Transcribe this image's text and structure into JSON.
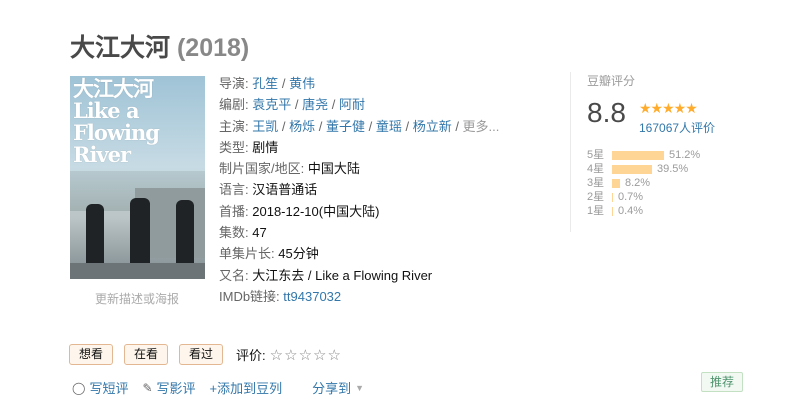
{
  "header": {
    "title": "大江大河",
    "year": "(2018)"
  },
  "poster": {
    "title_text": "大江大河\nLike a\nFlowing\nRiver",
    "update_link": "更新描述或海报"
  },
  "info": {
    "director": {
      "label": "导演:",
      "people": [
        "孔笙",
        "黄伟"
      ]
    },
    "writer": {
      "label": "编剧:",
      "people": [
        "袁克平",
        "唐尧",
        "阿耐"
      ]
    },
    "cast": {
      "label": "主演:",
      "people": [
        "王凯",
        "杨烁",
        "董子健",
        "童瑶",
        "杨立新"
      ],
      "more": "更多..."
    },
    "genre": {
      "label": "类型:",
      "value": "剧情"
    },
    "country": {
      "label": "制片国家/地区:",
      "value": "中国大陆"
    },
    "language": {
      "label": "语言:",
      "value": "汉语普通话"
    },
    "premiere": {
      "label": "首播:",
      "value": "2018-12-10(中国大陆)"
    },
    "episodes": {
      "label": "集数:",
      "value": "47"
    },
    "runtime": {
      "label": "单集片长:",
      "value": "45分钟"
    },
    "aka": {
      "label": "又名:",
      "value": "大江东去 / Like a Flowing River"
    },
    "imdb": {
      "label": "IMDb链接:",
      "value": "tt9437032"
    }
  },
  "rating": {
    "heading": "豆瓣评分",
    "score": "8.8",
    "stars": "★★★★★",
    "votes": "167067人评价",
    "distribution": [
      {
        "label": "5星",
        "percent": "51.2%",
        "value": 51.2
      },
      {
        "label": "4星",
        "percent": "39.5%",
        "value": 39.5
      },
      {
        "label": "3星",
        "percent": "8.2%",
        "value": 8.2
      },
      {
        "label": "2星",
        "percent": "0.7%",
        "value": 0.7
      },
      {
        "label": "1星",
        "percent": "0.4%",
        "value": 0.4
      }
    ]
  },
  "actions": {
    "want": "想看",
    "watching": "在看",
    "watched": "看过",
    "rate_label": "评价:",
    "rate_stars": "☆☆☆☆☆"
  },
  "links": {
    "short_review": "写短评",
    "review": "写影评",
    "add_list": "+添加到豆列",
    "share": "分享到"
  },
  "recommend": "推荐",
  "colors": {
    "link": "#3377aa",
    "bar": "#ffd596",
    "star": "#ffac2d",
    "recommend": "#4f946e"
  }
}
